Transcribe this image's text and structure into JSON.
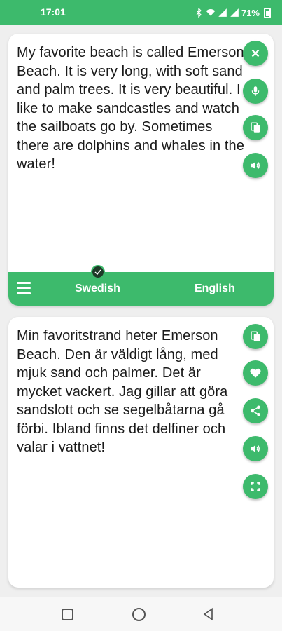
{
  "status_bar": {
    "time": "17:01",
    "battery_text": "71%",
    "icons": [
      "bluetooth-icon",
      "wifi-icon",
      "signal-icon",
      "signal-icon",
      "battery-icon"
    ]
  },
  "source_card": {
    "text": "My favorite beach is called Emerson Beach. It is very long, with soft sand and palm trees. It is very beautiful. I like to make sandcastles and watch the sailboats go by. Sometimes there are dolphins and whales in the water!",
    "actions": [
      "close-icon",
      "microphone-icon",
      "copy-icon",
      "speaker-icon"
    ]
  },
  "language_bar": {
    "source_language": "Swedish",
    "target_language": "English",
    "selected": "Swedish"
  },
  "target_card": {
    "text": "Min favoritstrand heter Emerson Beach. Den är väldigt lång, med mjuk sand och palmer. Det är mycket vackert. Jag gillar att göra sandslott och se segelbåtarna gå förbi. Ibland finns det delfiner och valar i vattnet!",
    "actions": [
      "copy-icon",
      "heart-icon",
      "share-icon",
      "speaker-icon",
      "fullscreen-icon"
    ]
  },
  "colors": {
    "accent": "#3dba6c",
    "background": "#efefef",
    "card": "#ffffff",
    "text": "#1a1a1a"
  },
  "nav_bar": {
    "buttons": [
      "recents-icon",
      "home-icon",
      "back-icon"
    ]
  }
}
